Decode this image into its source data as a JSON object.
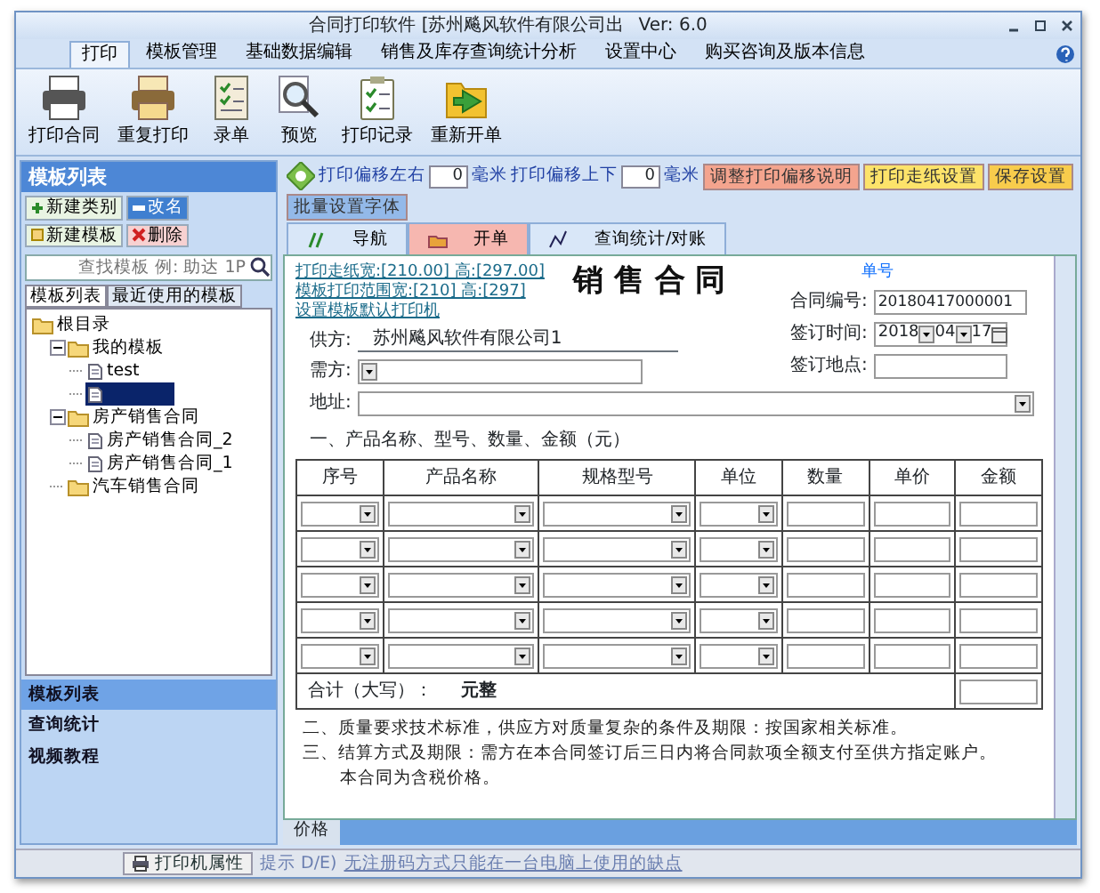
{
  "window": {
    "title": "合同打印软件 [苏州飚风软件有限公司出",
    "version": "Ver: 6.0"
  },
  "ribbon_tabs": [
    {
      "label": "打印",
      "selected": true
    },
    {
      "label": "模板管理",
      "selected": false
    },
    {
      "label": "基础数据编辑",
      "selected": false
    },
    {
      "label": "销售及库存查询统计分析",
      "selected": false
    },
    {
      "label": "设置中心",
      "selected": false
    },
    {
      "label": "购买咨询及版本信息",
      "selected": false
    }
  ],
  "ribbon_buttons": [
    {
      "label": "打印合同",
      "kind": "printer"
    },
    {
      "label": "重复打印",
      "kind": "printer-color"
    },
    {
      "label": "录单",
      "kind": "form"
    },
    {
      "label": "预览",
      "kind": "magnifier"
    },
    {
      "label": "打印记录",
      "kind": "clipboard"
    },
    {
      "label": "重新开单",
      "kind": "folder"
    }
  ],
  "sidebar": {
    "title": "模板列表",
    "buttons": [
      {
        "label": "新建类别",
        "kind": "add"
      },
      {
        "label": "改名",
        "kind": "rename"
      },
      {
        "label": "新建模板",
        "kind": "new"
      },
      {
        "label": "删除",
        "kind": "delete"
      }
    ],
    "search": {
      "placeholder": "查找模板 例: 助达 1P"
    },
    "tabs": [
      {
        "label": "模板列表",
        "selected": true
      },
      {
        "label": "最近使用的模板",
        "selected": false
      }
    ],
    "tree": [
      {
        "label": "根目录",
        "kind": "folder",
        "selected": false,
        "children": [
          {
            "label": "我的模板",
            "kind": "folder",
            "selected": false,
            "children": [
              {
                "label": "test",
                "kind": "doc",
                "selected": false
              },
              {
                "kind": "doc",
                "selected": true
              }
            ]
          },
          {
            "label": "房产销售合同",
            "kind": "folder",
            "selected": false,
            "children": [
              {
                "label": "房产销售合同_2",
                "kind": "doc",
                "selected": false
              },
              {
                "label": "房产销售合同_1",
                "kind": "doc",
                "selected": false
              }
            ]
          },
          {
            "label": "汽车销售合同",
            "kind": "folder",
            "selected": false
          }
        ]
      }
    ],
    "sections": [
      {
        "label": "模板列表",
        "selected": true
      },
      {
        "label": "查询统计",
        "selected": false
      },
      {
        "label": "视频教程",
        "selected": false
      }
    ]
  },
  "toolbar": {
    "offsets": [
      {
        "label": "打印偏移左右",
        "value": "0",
        "unit": "毫米"
      },
      {
        "label": "打印偏移上下",
        "value": "0",
        "unit": "毫米"
      }
    ],
    "buttons": [
      {
        "label": "调整打印偏移说明",
        "color": "#f4a48e"
      },
      {
        "label": "打印走纸设置",
        "color": "#fde36a"
      },
      {
        "label": "保存设置",
        "color": "#f8cc4c"
      },
      {
        "label": "批量设置字体",
        "color": "#93b9e9"
      }
    ]
  },
  "doc_tabs": [
    {
      "label": "导航",
      "kind": "nav",
      "selected": false
    },
    {
      "label": "开单",
      "kind": "order",
      "selected": true
    },
    {
      "label": "查询统计/对账",
      "kind": "stats",
      "selected": false
    }
  ],
  "document": {
    "links": [
      "打印走纸宽:[210.00] 高:[297.00]",
      "模板打印范围宽:[210] 高:[297]",
      "设置模板默认打印机"
    ],
    "title": "销 售 合 同",
    "number_caption": "单号",
    "number_label": "合同编号:",
    "number": "20180417000001",
    "date_label": "签订时间:",
    "date": {
      "year": "2018",
      "month": "04",
      "day": "17"
    },
    "place_label": "签订地点:",
    "supplier_label": "供方:",
    "supplier": "苏州飚风软件有限公司1",
    "buyer_label": "需方:",
    "address_label": "地址:",
    "section_heading": "一、产品名称、型号、数量、金额（元）",
    "columns": [
      {
        "label": "序号",
        "kind": "select"
      },
      {
        "label": "产品名称",
        "kind": "select"
      },
      {
        "label": "规格型号",
        "kind": "select"
      },
      {
        "label": "单位",
        "kind": "select"
      },
      {
        "label": "数量",
        "kind": "input"
      },
      {
        "label": "单价",
        "kind": "input"
      },
      {
        "label": "金额",
        "kind": "input"
      }
    ],
    "rows": [
      {
        "kind": "blank"
      },
      {
        "kind": "blank"
      },
      {
        "kind": "blank"
      },
      {
        "kind": "blank"
      },
      {
        "kind": "blank"
      }
    ],
    "total_label": "合计（大写）：",
    "total_unit": "元整",
    "paragraphs": [
      "二、质量要求技术标准，供应方对质量复杂的条件及期限：按国家相关标准。",
      "三、结算方式及期限：需方在本合同签订后三日内将合同款项全额支付至供方指定账户。",
      "本合同为含税价格。"
    ]
  },
  "bottom_tab": "价格",
  "status_bar": {
    "printer_button": "打印机属性",
    "hint_label": "提示 D/E)",
    "hint": "无注册码方式只能在一台电脑上使用的缺点"
  }
}
